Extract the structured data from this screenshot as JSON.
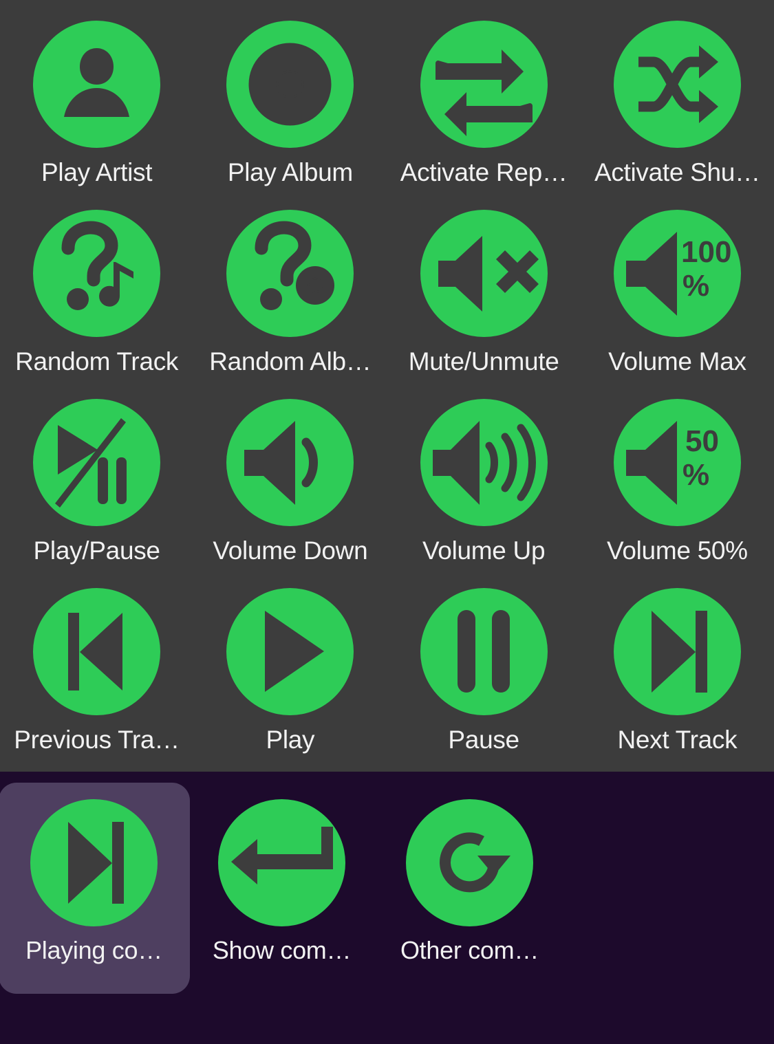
{
  "theme": {
    "top_background": "#3c3c3c",
    "bottom_background": "#1d0a2c",
    "bubble_green": "#2ecc57",
    "glyph_dark": "#3d3d3d",
    "label_color": "#f2f2f2",
    "selected_card": "#4e3f60"
  },
  "top_section": {
    "items": [
      {
        "label": "Play Artist",
        "icon": "person-icon"
      },
      {
        "label": "Play Album",
        "icon": "disc-icon"
      },
      {
        "label": "Activate Rep…",
        "icon": "repeat-icon"
      },
      {
        "label": "Activate Shu…",
        "icon": "shuffle-icon"
      },
      {
        "label": "Random Track",
        "icon": "question-music-note-icon"
      },
      {
        "label": "Random Alb…",
        "icon": "question-disc-icon"
      },
      {
        "label": "Mute/Unmute",
        "icon": "speaker-mute-icon"
      },
      {
        "label": "Volume Max",
        "icon": "speaker-percent-icon",
        "value": "100",
        "unit": "%"
      },
      {
        "label": "Play/Pause",
        "icon": "play-pause-slash-icon"
      },
      {
        "label": "Volume Down",
        "icon": "speaker-low-icon"
      },
      {
        "label": "Volume Up",
        "icon": "speaker-high-icon"
      },
      {
        "label": "Volume 50%",
        "icon": "speaker-percent-icon",
        "value": "50",
        "unit": "%"
      },
      {
        "label": "Previous Tra…",
        "icon": "previous-track-icon"
      },
      {
        "label": "Play",
        "icon": "play-icon"
      },
      {
        "label": "Pause",
        "icon": "pause-icon"
      },
      {
        "label": "Next Track",
        "icon": "next-track-icon"
      }
    ]
  },
  "bottom_section": {
    "items": [
      {
        "label": "Playing co…",
        "icon": "next-track-icon",
        "selected": true
      },
      {
        "label": "Show com…",
        "icon": "enter-arrow-icon",
        "selected": false
      },
      {
        "label": "Other com…",
        "icon": "refresh-icon",
        "selected": false
      }
    ]
  }
}
